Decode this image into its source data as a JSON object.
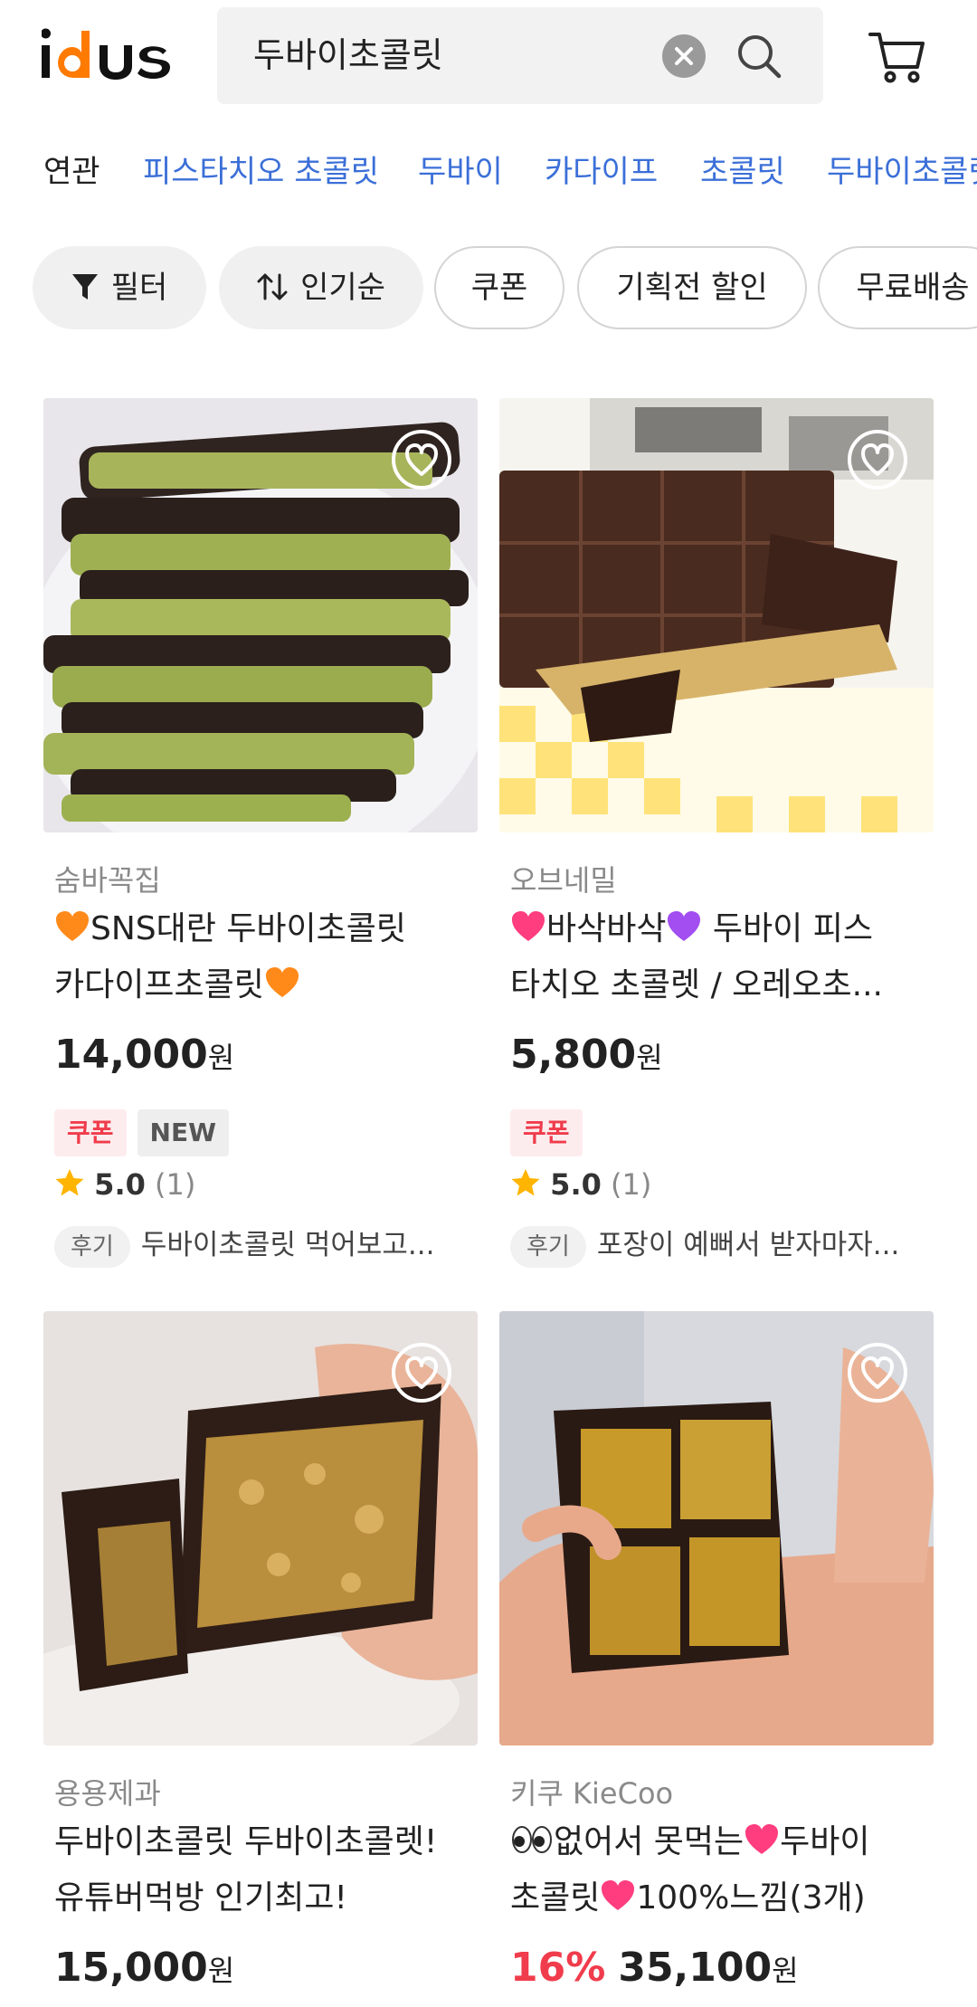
{
  "header": {
    "logo_text": "idus",
    "search_value": "두바이초콜릿",
    "icons": [
      "clear-icon",
      "search-icon",
      "cart-icon"
    ]
  },
  "related": {
    "label": "연관",
    "keywords": [
      "피스타치오 초콜릿",
      "두바이",
      "카다이프",
      "초콜릿",
      "두바이초콜릿"
    ]
  },
  "chips": {
    "filter": "필터",
    "sort": "인기순",
    "coupon": "쿠폰",
    "promo": "기획전 할인",
    "free_shipping": "무료배송"
  },
  "products": [
    {
      "seller": "숨바꼭집",
      "title_line1": "SNS대란 두바이초콜릿",
      "title_line2": "카다이프초콜릿",
      "price": "14,000",
      "currency": "원",
      "badge_coupon": "쿠폰",
      "badge_new": "NEW",
      "rating": "5.0",
      "rating_count": "(1)",
      "review_tag": "후기",
      "review_text": "두바이초콜릿 먹어보고..."
    },
    {
      "seller": "오브네밀",
      "title_line1a": "바삭바삭",
      "title_line1b": " 두바이 피스",
      "title_line2": "타치오 초콜렛 / 오레오초...",
      "price": "5,800",
      "currency": "원",
      "badge_coupon": "쿠폰",
      "rating": "5.0",
      "rating_count": "(1)",
      "review_tag": "후기",
      "review_text": "포장이 예뻐서 받자마자..."
    },
    {
      "seller": "용용제과",
      "title_line1": "두바이초콜릿 두바이초콜렛!",
      "title_line2": "유튜버먹방 인기최고!",
      "price": "15,000",
      "currency": "원"
    },
    {
      "seller": "키쿠 KieCoo",
      "title_line1a": "없어서 못먹는",
      "title_line1b": "두바이",
      "title_line2a": "초콜릿",
      "title_line2b": "100%느낌(3개)",
      "discount": "16%",
      "price": "35,100",
      "currency": "원"
    }
  ],
  "colors": {
    "accent_blue": "#3b6fd8",
    "logo_orange": "#ff7a00",
    "discount_red": "#f03c4c",
    "star": "#ffb400"
  }
}
